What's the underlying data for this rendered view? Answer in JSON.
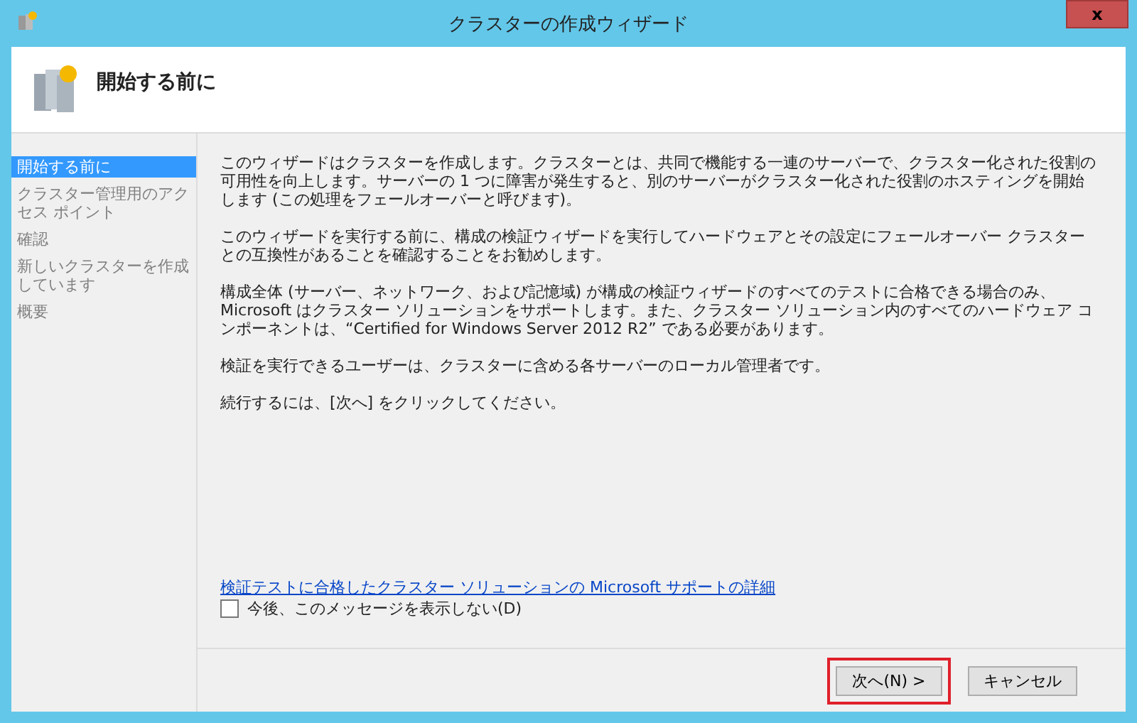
{
  "window": {
    "title": "クラスターの作成ウィザード",
    "close": "x"
  },
  "header": {
    "title": "開始する前に"
  },
  "steps": [
    {
      "label": "開始する前に",
      "selected": true
    },
    {
      "label": "クラスター管理用のアクセス ポイント",
      "selected": false
    },
    {
      "label": "確認",
      "selected": false
    },
    {
      "label": "新しいクラスターを作成しています",
      "selected": false
    },
    {
      "label": "概要",
      "selected": false
    }
  ],
  "paragraphs": [
    "このウィザードはクラスターを作成します。クラスターとは、共同で機能する一連のサーバーで、クラスター化された役割の可用性を向上します。サーバーの 1 つに障害が発生すると、別のサーバーがクラスター化された役割のホスティングを開始します (この処理をフェールオーバーと呼びます)。",
    "このウィザードを実行する前に、構成の検証ウィザードを実行してハードウェアとその設定にフェールオーバー クラスターとの互換性があることを確認することをお勧めします。",
    "構成全体 (サーバー、ネットワーク、および記憶域) が構成の検証ウィザードのすべてのテストに合格できる場合のみ、Microsoft はクラスター ソリューションをサポートします。また、クラスター ソリューション内のすべてのハードウェア コンポーネントは、“Certified for Windows Server 2012 R2” である必要があります。",
    "検証を実行できるユーザーは、クラスターに含める各サーバーのローカル管理者です。",
    "続行するには、[次へ] をクリックしてください。"
  ],
  "link": "検証テストに合格したクラスター ソリューションの Microsoft サポートの詳細",
  "checkbox": {
    "label": "今後、このメッセージを表示しない(D)",
    "checked": false
  },
  "buttons": [
    {
      "label": "次へ(N) >",
      "highlighted": true
    },
    {
      "label": "キャンセル",
      "highlighted": false
    }
  ]
}
